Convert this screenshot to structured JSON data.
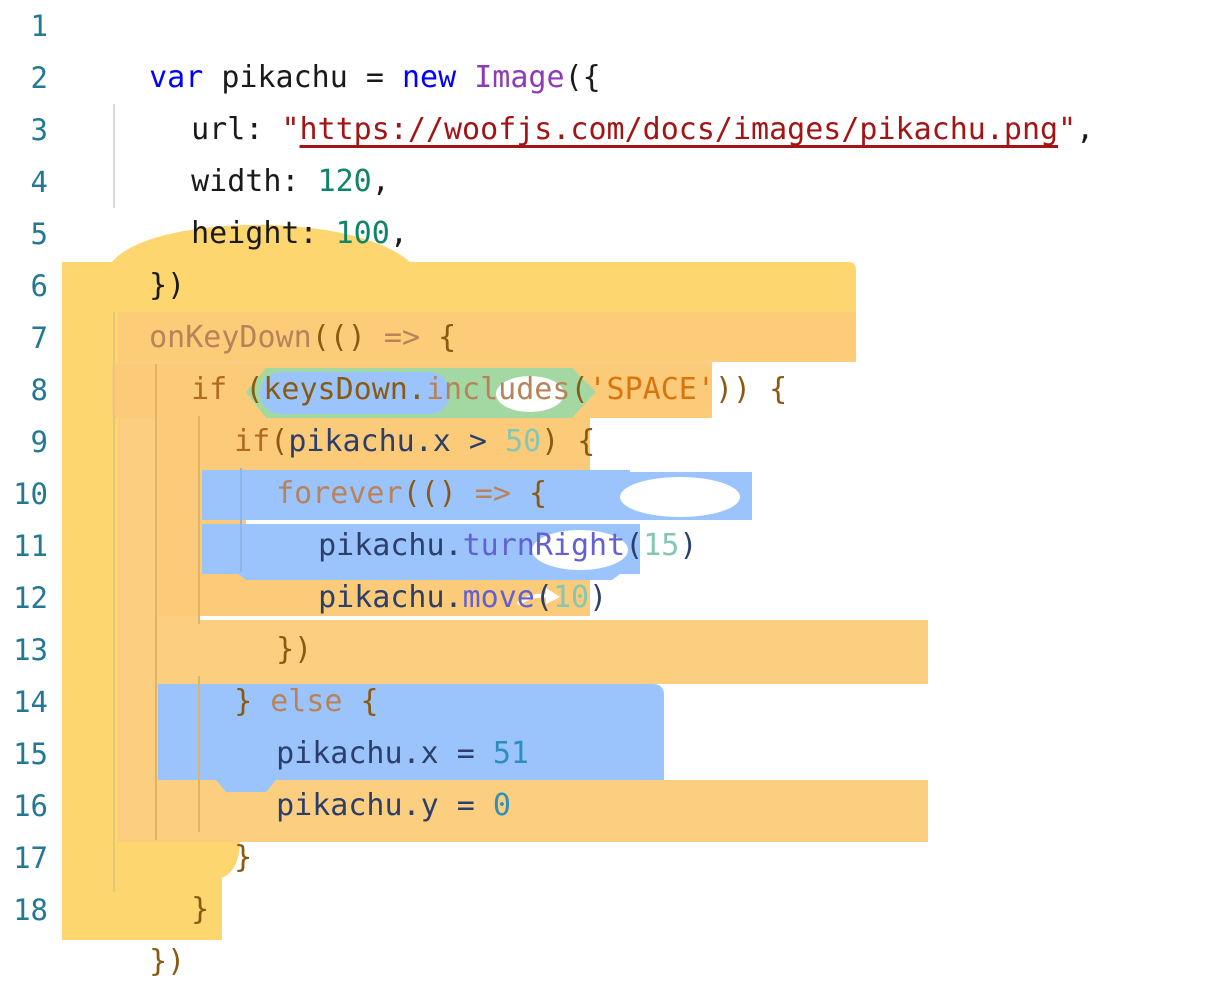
{
  "editor": {
    "line_numbers": [
      "1",
      "2",
      "3",
      "4",
      "5",
      "6",
      "7",
      "8",
      "9",
      "10",
      "11",
      "12",
      "13",
      "14",
      "15",
      "16",
      "17",
      "18"
    ],
    "line1": {
      "kw_var": "var",
      "ident": " pikachu = ",
      "kw_new": "new",
      "cls": "Image",
      "end": "({"
    },
    "line2": {
      "key": "url: ",
      "quote_open": "\"",
      "url": "https://woofjs.com/docs/images/pikachu.png",
      "quote_close": "\"",
      "comma": ","
    },
    "line3": {
      "key": "width: ",
      "value": "120",
      "comma": ","
    },
    "line4": {
      "key": "height: ",
      "value": "100",
      "comma": ","
    },
    "line5": {
      "text": "})"
    },
    "line6": {
      "event": "onKeyDown",
      "paren": "(()",
      "arrow": " => ",
      "brace": "{"
    },
    "line7": {
      "kw": "if ",
      "open": "(",
      "obj": "keysDown.",
      "method": "includes",
      "paren": "(",
      "str": "'SPACE'",
      "close": ")) ",
      "brace": "{"
    },
    "line8": {
      "kw": "if",
      "open": "(",
      "obj": "pikachu.x",
      "op": " > ",
      "value": "50",
      "close": ")",
      "brace": " {"
    },
    "line9": {
      "kw": "forever",
      "paren": "(()",
      "arrow": " => ",
      "brace": "{"
    },
    "line10": {
      "obj": "pikachu.",
      "method": "turnRight",
      "open": "(",
      "value": "15",
      "close": ")"
    },
    "line11": {
      "obj": "pikachu.",
      "method": "move",
      "open": "(",
      "value": "10",
      "close": ")"
    },
    "line12": {
      "text": "})"
    },
    "line13": {
      "close": "} ",
      "kw": "else",
      "brace": " {"
    },
    "line14": {
      "text": "pikachu.x = ",
      "value": "51"
    },
    "line15": {
      "text": "pikachu.y = ",
      "value": "0"
    },
    "line16": {
      "text": "}"
    },
    "line17": {
      "text": "}"
    },
    "line18": {
      "text": "})"
    }
  },
  "colors": {
    "event_block": "#fdd66f",
    "control_block": "#fccb79",
    "motion_block": "#9cc4fc",
    "operator_block": "#a3d8a3",
    "line_number": "#237893"
  },
  "icons": {
    "loop_arrow": "loop-arrow-icon"
  }
}
